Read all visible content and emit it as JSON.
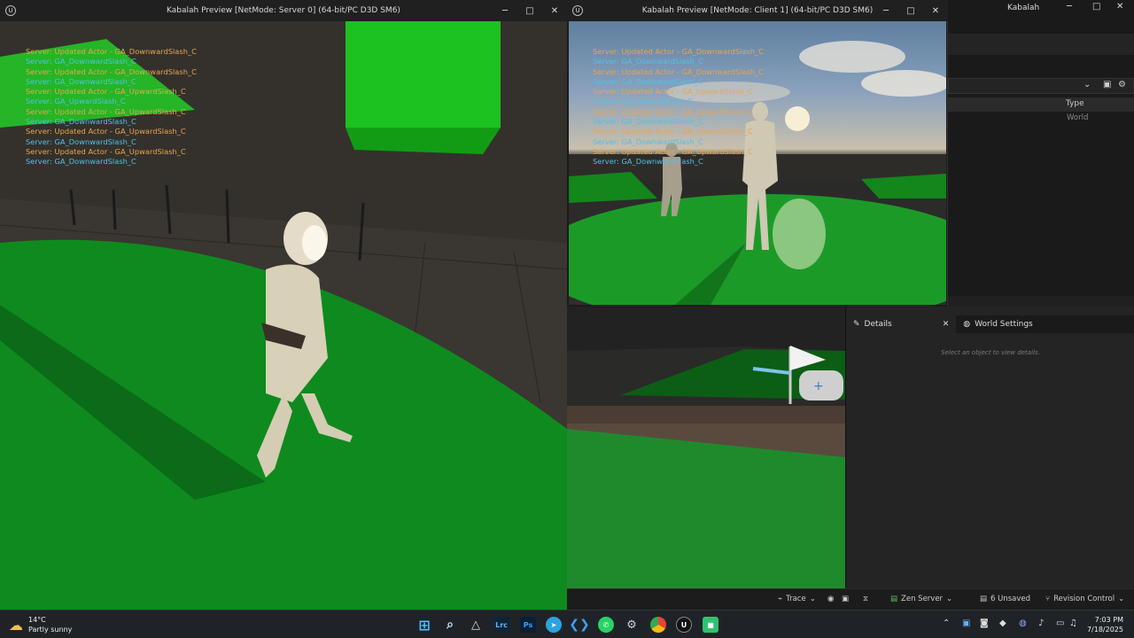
{
  "server_window": {
    "title": "Kabalah Preview [NetMode: Server 0]  (64-bit/PC D3D SM6)",
    "minimize": "─",
    "maximize": "□",
    "close": "✕",
    "log": [
      {
        "text": "Server: Updated Actor - GA_DownwardSlash_C",
        "color": "orange"
      },
      {
        "text": "Server: GA_DownwardSlash_C",
        "color": "cyan"
      },
      {
        "text": "Server: Updated Actor - GA_DownwardSlash_C",
        "color": "orange"
      },
      {
        "text": "Server: GA_DownwardSlash_C",
        "color": "cyan"
      },
      {
        "text": "Server: Updated Actor - GA_UpwardSlash_C",
        "color": "orange"
      },
      {
        "text": "Server: GA_UpwardSlash_C",
        "color": "cyan"
      },
      {
        "text": "Server: Updated Actor - GA_UpwardSlash_C",
        "color": "orange"
      },
      {
        "text": "Server: GA_DownwardSlash_C",
        "color": "cyan"
      },
      {
        "text": "Server: Updated Actor - GA_UpwardSlash_C",
        "color": "orange"
      },
      {
        "text": "Server: GA_DownwardSlash_C",
        "color": "cyan"
      },
      {
        "text": "Server: Updated Actor - GA_UpwardSlash_C",
        "color": "orange"
      },
      {
        "text": "Server: GA_DownwardSlash_C",
        "color": "cyan"
      }
    ]
  },
  "client_window": {
    "title": "Kabalah Preview [NetMode: Client 1]  (64-bit/PC D3D SM6)",
    "minimize": "─",
    "maximize": "□",
    "close": "✕",
    "log": [
      {
        "text": "Server: Updated Actor - GA_DownwardSlash_C",
        "color": "orange"
      },
      {
        "text": "Server: GA_DownwardSlash_C",
        "color": "cyan"
      },
      {
        "text": "Server: Updated Actor - GA_DownwardSlash_C",
        "color": "orange"
      },
      {
        "text": "Server: GA_DownwardSlash_C",
        "color": "cyan"
      },
      {
        "text": "Server: Updated Actor - GA_UpwardSlash_C",
        "color": "orange"
      },
      {
        "text": "Server: GA_UpwardSlash_C",
        "color": "cyan"
      },
      {
        "text": "Server: Updated Actor - GA_UpwardSlash_C",
        "color": "orange"
      },
      {
        "text": "Server: GA_DownwardSlash_C",
        "color": "cyan"
      },
      {
        "text": "Server: Updated Actor - GA_UpwardSlash_C",
        "color": "orange"
      },
      {
        "text": "Server: GA_DownwardSlash_C",
        "color": "cyan"
      },
      {
        "text": "Server: Updated Actor - GA_UpwardSlash_C",
        "color": "orange"
      },
      {
        "text": "Server: GA_DownwardSlash_C",
        "color": "cyan"
      }
    ]
  },
  "editor": {
    "window_title": "Kabalah",
    "minimize": "─",
    "maximize": "□",
    "close": "✕",
    "outliner_column_type": "Type",
    "outliner_row_type": "World",
    "details_tab": "Details",
    "world_settings_tab": "World Settings",
    "details_empty": "Select an object to view details."
  },
  "statusbar": {
    "trace": "Trace",
    "zen_server": "Zen Server",
    "unsaved": "6 Unsaved",
    "revision_control": "Revision Control"
  },
  "taskbar": {
    "weather_temp": "14°C",
    "weather_desc": "Partly sunny",
    "time": "7:03 PM",
    "date": "7/18/2025",
    "apps": [
      "Start",
      "Search",
      "Affinity",
      "Lightroom",
      "Photoshop",
      "Telegram",
      "VS Code",
      "WhatsApp",
      "Steam",
      "Chrome",
      "Unreal Engine",
      "App"
    ]
  },
  "colors": {
    "log_orange": "#e9a54e",
    "log_cyan": "#4fc2e8",
    "ground_green": "#0f8a1f"
  }
}
